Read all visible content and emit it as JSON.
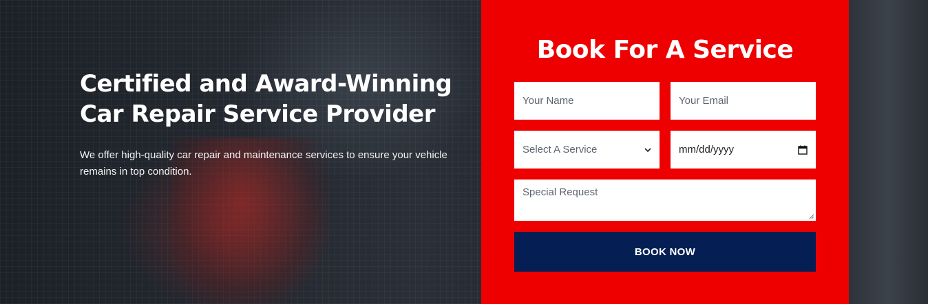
{
  "hero": {
    "headline_line1": "Certified and Award-Winning",
    "headline_line2": "Car Repair Service Provider",
    "lead": "We offer high-quality car repair and maintenance services to ensure your vehicle remains in top condition."
  },
  "booking": {
    "title": "Book For A Service",
    "name_placeholder": "Your Name",
    "email_placeholder": "Your Email",
    "service_selected": "Select A Service",
    "date_placeholder": "mm/dd/yyyy",
    "request_placeholder": "Special Request",
    "submit_label": "BOOK NOW"
  },
  "icons": {
    "service_dropdown": "chevron-down-icon",
    "date_picker": "calendar-icon",
    "textarea_resize": "resize-handle-icon"
  },
  "colors": {
    "panel_red": "#ee0000",
    "button_navy": "#051f54",
    "text_white": "#ffffff"
  }
}
